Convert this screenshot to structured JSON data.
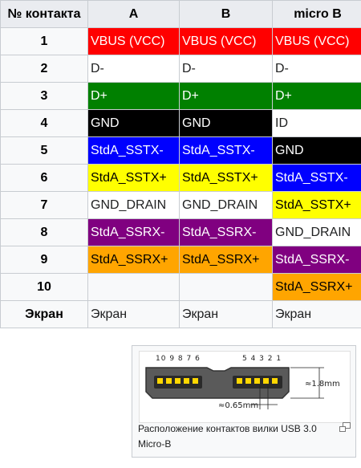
{
  "table": {
    "headers": [
      "№ контакта",
      "A",
      "B",
      "micro B"
    ],
    "rows": [
      {
        "pin": "1",
        "cells": [
          {
            "text": "VBUS (VCC)",
            "color": "#ff0000"
          },
          {
            "text": "VBUS (VCC)",
            "color": "#ff0000"
          },
          {
            "text": "VBUS (VCC)",
            "color": "#ff0000"
          }
        ]
      },
      {
        "pin": "2",
        "cells": [
          {
            "text": "D-",
            "color": "#ffffff"
          },
          {
            "text": "D-",
            "color": "#ffffff"
          },
          {
            "text": "D-",
            "color": "#ffffff"
          }
        ]
      },
      {
        "pin": "3",
        "cells": [
          {
            "text": "D+",
            "color": "#008000"
          },
          {
            "text": "D+",
            "color": "#008000"
          },
          {
            "text": "D+",
            "color": "#008000"
          }
        ]
      },
      {
        "pin": "4",
        "cells": [
          {
            "text": "GND",
            "color": "#000000"
          },
          {
            "text": "GND",
            "color": "#000000"
          },
          {
            "text": "ID",
            "color": "#ffffff"
          }
        ]
      },
      {
        "pin": "5",
        "cells": [
          {
            "text": "StdA_SSTX-",
            "color": "#0000ff"
          },
          {
            "text": "StdA_SSTX-",
            "color": "#0000ff"
          },
          {
            "text": "GND",
            "color": "#000000"
          }
        ]
      },
      {
        "pin": "6",
        "cells": [
          {
            "text": "StdA_SSTX+",
            "color": "#ffff00"
          },
          {
            "text": "StdA_SSTX+",
            "color": "#ffff00"
          },
          {
            "text": "StdA_SSTX-",
            "color": "#0000ff"
          }
        ]
      },
      {
        "pin": "7",
        "cells": [
          {
            "text": "GND_DRAIN",
            "color": "#ffffff"
          },
          {
            "text": "GND_DRAIN",
            "color": "#ffffff"
          },
          {
            "text": "StdA_SSTX+",
            "color": "#ffff00"
          }
        ]
      },
      {
        "pin": "8",
        "cells": [
          {
            "text": "StdA_SSRX-",
            "color": "#800080"
          },
          {
            "text": "StdA_SSRX-",
            "color": "#800080"
          },
          {
            "text": "GND_DRAIN",
            "color": "#ffffff"
          }
        ]
      },
      {
        "pin": "9",
        "cells": [
          {
            "text": "StdA_SSRX+",
            "color": "#ffa500"
          },
          {
            "text": "StdA_SSRX+",
            "color": "#ffa500"
          },
          {
            "text": "StdA_SSRX-",
            "color": "#800080"
          }
        ]
      },
      {
        "pin": "10",
        "cells": [
          {
            "text": "",
            "color": "#f8f9fa"
          },
          {
            "text": "",
            "color": "#f8f9fa"
          },
          {
            "text": "StdA_SSRX+",
            "color": "#ffa500"
          }
        ]
      },
      {
        "pin": "Экран",
        "cells": [
          {
            "text": "Экран",
            "color": "#f8f9fa"
          },
          {
            "text": "Экран",
            "color": "#f8f9fa"
          },
          {
            "text": "Экран",
            "color": "#f8f9fa"
          }
        ]
      }
    ]
  },
  "thumbnail": {
    "caption": "Расположение контактов вилки USB 3.0 Micro-B",
    "enlarge_icon": "magnify-clip-icon",
    "diagram": {
      "pins_left": "10 9 8 7 6",
      "pins_right": "5 4 3 2 1",
      "dim_height": "≈1.8mm",
      "dim_gap": "≈0.65mm"
    }
  }
}
